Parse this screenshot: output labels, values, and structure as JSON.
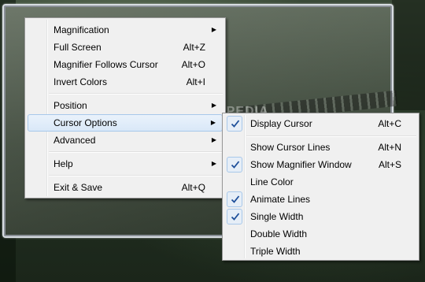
{
  "watermark": "SOFTPEDIA",
  "main_menu": {
    "items": [
      {
        "label": "Magnification",
        "shortcut": "",
        "submenu": true
      },
      {
        "label": "Full Screen",
        "shortcut": "Alt+Z",
        "submenu": false
      },
      {
        "label": "Magnifier Follows Cursor",
        "shortcut": "Alt+O",
        "submenu": false
      },
      {
        "label": "Invert Colors",
        "shortcut": "Alt+I",
        "submenu": false
      },
      {
        "label": "Position",
        "shortcut": "",
        "submenu": true
      },
      {
        "label": "Cursor Options",
        "shortcut": "",
        "submenu": true
      },
      {
        "label": "Advanced",
        "shortcut": "",
        "submenu": true
      },
      {
        "label": "Help",
        "shortcut": "",
        "submenu": true
      },
      {
        "label": "Exit  & Save",
        "shortcut": "Alt+Q",
        "submenu": false
      }
    ],
    "highlighted": "Cursor Options"
  },
  "cursor_options_menu": {
    "items": [
      {
        "label": "Display Cursor",
        "shortcut": "Alt+C",
        "checked": true
      },
      {
        "label": "Show Cursor Lines",
        "shortcut": "Alt+N",
        "checked": false
      },
      {
        "label": "Show Magnifier Window",
        "shortcut": "Alt+S",
        "checked": true
      },
      {
        "label": "Line Color",
        "shortcut": "",
        "checked": false
      },
      {
        "label": "Animate Lines",
        "shortcut": "",
        "checked": true
      },
      {
        "label": "Single Width",
        "shortcut": "",
        "checked": true
      },
      {
        "label": "Double Width",
        "shortcut": "",
        "checked": false
      },
      {
        "label": "Triple Width",
        "shortcut": "",
        "checked": false
      }
    ]
  },
  "colors": {
    "menu_bg": "#f0f0f0",
    "highlight": "#d9e8f8",
    "check_mark": "#1e4f9a"
  }
}
